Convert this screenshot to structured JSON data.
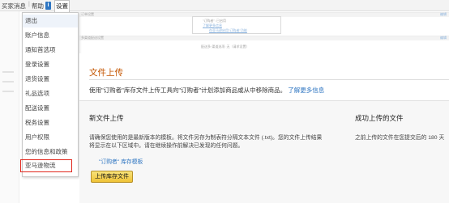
{
  "topbar": {
    "messages": "买家消息",
    "help": "帮助",
    "info_badge": "i",
    "settings": "设置"
  },
  "background_page": {
    "bar1_left": "订单设置",
    "bar1_right": "编辑",
    "hl_line1": "\"订购者\": 已启用",
    "hl_link1": "了解更多信息",
    "hl_link2": "在亚马逊启用\"订购者\"功能",
    "bar2_left": "多渠道配送设置",
    "bar2_right": "编辑",
    "bottom_line": "配送多·渠道选项: 无（请求设置）"
  },
  "dropdown": {
    "items": [
      "退出",
      "账户信息",
      "通知首选项",
      "登录设置",
      "退货设置",
      "礼品选项",
      "配送设置",
      "税务设置",
      "用户权限",
      "您的信息和政策",
      "亚马逊物流"
    ]
  },
  "main": {
    "title": "文件上传",
    "description": "使用\"订购者\"库存文件上传工具向\"订购者\"计划添加商品或从中移除商品。",
    "learn_more": "了解更多信息",
    "section_left_title": "新文件上传",
    "section_left_line1": "请确保您使用的是最新版本的模板。将文件另存为制表符分隔文本文件 (.txt)。您的文件上传结果",
    "section_left_line2": "将显示在以下区域中。请在继续操作前解决已发现的任何问题。",
    "template_link": "\"订购者\" 库存模板",
    "upload_button": "上传库存文件",
    "section_right_title": "成功上传的文件",
    "section_right_text": "之前上传的文件在您提交后的 180 天"
  }
}
